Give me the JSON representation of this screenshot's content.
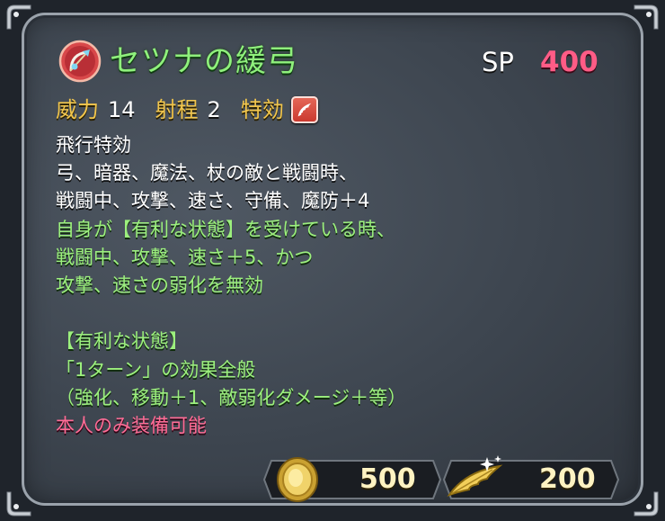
{
  "skill": {
    "name": "セツナの緩弓",
    "icon": "weapon-bow-icon",
    "sp_label": "SP",
    "sp_value": "400"
  },
  "stats": {
    "might_label": "威力",
    "might_value": "14",
    "range_label": "射程",
    "range_value": "2",
    "effective_label": "特効",
    "effective_icon": "flier-effective-icon"
  },
  "description": {
    "white_lines": [
      "飛行特効",
      "弓、暗器、魔法、杖の敵と戦闘時、",
      "戦闘中、攻撃、速さ、守備、魔防＋4"
    ],
    "green_lines": [
      "自身が【有利な状態】を受けている時、",
      "戦闘中、攻撃、速さ＋5、かつ",
      "攻撃、速さの弱化を無効",
      "",
      "【有利な状態】",
      "「1ターン」の効果全般",
      "（強化、移動＋1、敵弱化ダメージ＋等）"
    ],
    "pink_line": "本人のみ装備可能"
  },
  "costs": {
    "gold_icon": "gold-coin-icon",
    "gold_value": "500",
    "feather_icon": "hero-feather-icon",
    "feather_value": "200"
  },
  "colors": {
    "title": "#8ff07c",
    "stat_label": "#f2c64c",
    "sp_value": "#ff5c86",
    "green_text": "#9cf07d",
    "pink_text": "#ff6b95"
  }
}
